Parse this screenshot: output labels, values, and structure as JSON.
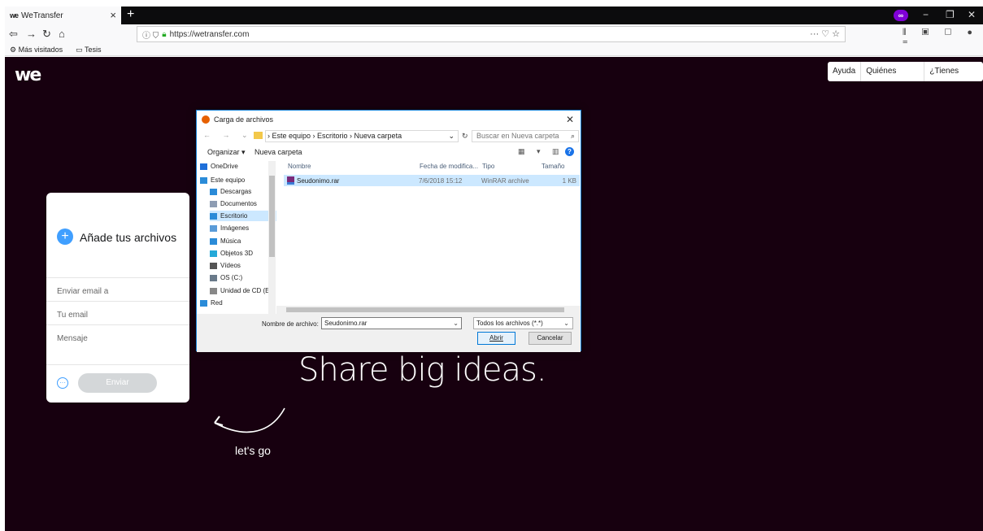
{
  "browser": {
    "tab_title": "WeTransfer",
    "tab_favicon_text": "we",
    "tab_close": "×",
    "new_tab": "+",
    "url": "https://wetransfer.com",
    "url_info": "ⓘ ⛉",
    "url_actions": "··· ♡ ☆",
    "private_badge": "∞",
    "window_minimize": "−",
    "window_restore": "❐",
    "window_close": "✕",
    "bookmarks": [
      {
        "label": "Más visitados",
        "icon": "gear-icon"
      },
      {
        "label": "Tesis",
        "icon": "folder-icon"
      }
    ],
    "toolbar_icons": "⫴ ▣ ▢ ● ≡"
  },
  "page": {
    "logo": "we",
    "nav": [
      "Ayuda",
      "Quiénes somos",
      "¿Tienes Plus?"
    ],
    "panel": {
      "add_files": "Añade tus archivos",
      "add_icon": "+",
      "email_to_placeholder": "Enviar email a",
      "your_email_placeholder": "Tu email",
      "message_placeholder": "Mensaje",
      "options_icon": "···",
      "send_label": "Enviar"
    },
    "headline": "Share big ideas.",
    "lets_go": "let's go"
  },
  "dialog": {
    "title": "Carga de archivos",
    "close": "✕",
    "nav_arrows": "← → ⌄ ↑",
    "breadcrumb": "› Este equipo › Escritorio › Nueva carpeta",
    "breadcrumb_dropdown": "⌄",
    "refresh": "↻",
    "search_placeholder": "Buscar en Nueva carpeta",
    "search_icon": "⌕",
    "organize": "Organizar ▾",
    "new_folder": "Nueva carpeta",
    "view_icons": "▦ ▾ ▥",
    "help": "?",
    "tree": [
      {
        "label": "OneDrive",
        "color": "#1e6fd9",
        "selected": false
      },
      {
        "label": "Este equipo",
        "color": "#2a8bd8",
        "selected": false
      },
      {
        "label": "Descargas",
        "color": "#2a8bd8",
        "selected": false
      },
      {
        "label": "Documentos",
        "color": "#8e9db3",
        "selected": false
      },
      {
        "label": "Escritorio",
        "color": "#2a8bd8",
        "selected": true
      },
      {
        "label": "Imágenes",
        "color": "#5a9bd8",
        "selected": false
      },
      {
        "label": "Música",
        "color": "#2a8bd8",
        "selected": false
      },
      {
        "label": "Objetos 3D",
        "color": "#25a9d8",
        "selected": false
      },
      {
        "label": "Vídeos",
        "color": "#555555",
        "selected": false
      },
      {
        "label": "OS (C:)",
        "color": "#6a7a8a",
        "selected": false
      },
      {
        "label": "Unidad de CD (E",
        "color": "#888888",
        "selected": false
      },
      {
        "label": "Red",
        "color": "#2a8bd8",
        "selected": false
      }
    ],
    "columns": [
      "Nombre",
      "Fecha de modifica...",
      "Tipo",
      "Tamaño"
    ],
    "files": [
      {
        "name": "Seudonimo.rar",
        "date": "7/6/2018 15:12",
        "type": "WinRAR archive",
        "size": "1 KB"
      }
    ],
    "filename_label": "Nombre de archivo:",
    "filename_value": "Seudonimo.rar",
    "filetype_value": "Todos los archivos (*.*)",
    "open_label": "Abrir",
    "cancel_label": "Cancelar",
    "dropdown_icon": "⌄"
  }
}
